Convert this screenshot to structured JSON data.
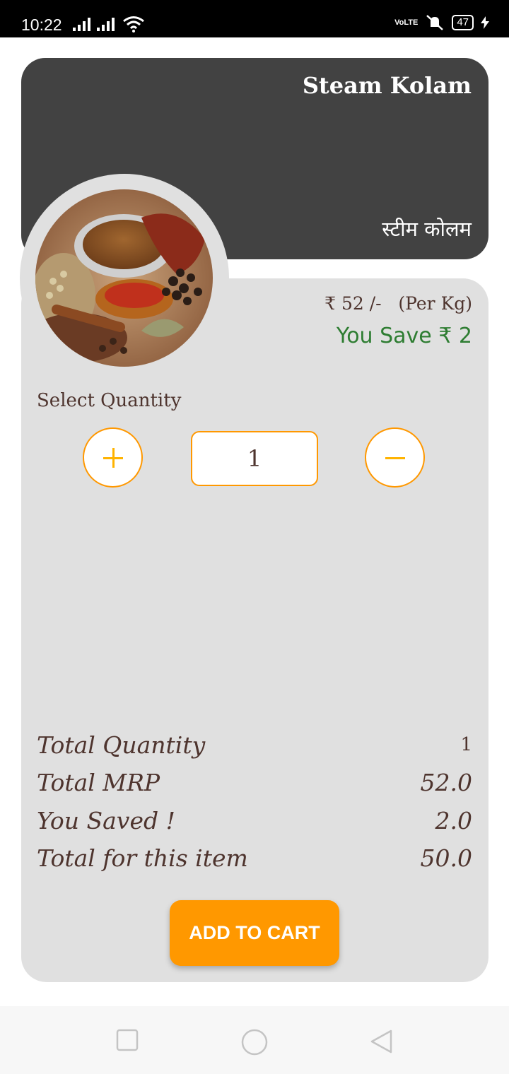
{
  "status_bar": {
    "time": "10:22",
    "volte": "VoLTE",
    "battery": "47"
  },
  "product": {
    "name_en": "Steam Kolam",
    "name_hi": "स्टीम कोलम",
    "price": "₹ 52 /-",
    "unit": "(Per Kg)",
    "savings": "You Save ₹ 2"
  },
  "quantity": {
    "label": "Select Quantity",
    "value": "1",
    "increment_icon": "plus-icon",
    "decrement_icon": "minus-icon"
  },
  "summary": [
    {
      "label": "Total Quantity",
      "value": "1"
    },
    {
      "label": "Total MRP",
      "value": "52.0"
    },
    {
      "label": "You Saved !",
      "value": "2.0"
    },
    {
      "label": "Total for this item",
      "value": "50.0"
    }
  ],
  "cart_button": {
    "label": "ADD TO CART"
  },
  "colors": {
    "accent": "#ff9800",
    "header_bg": "#424242",
    "card_bg": "#e0e0e0",
    "text_brown": "#4e342e",
    "save_green": "#2e7d32"
  }
}
